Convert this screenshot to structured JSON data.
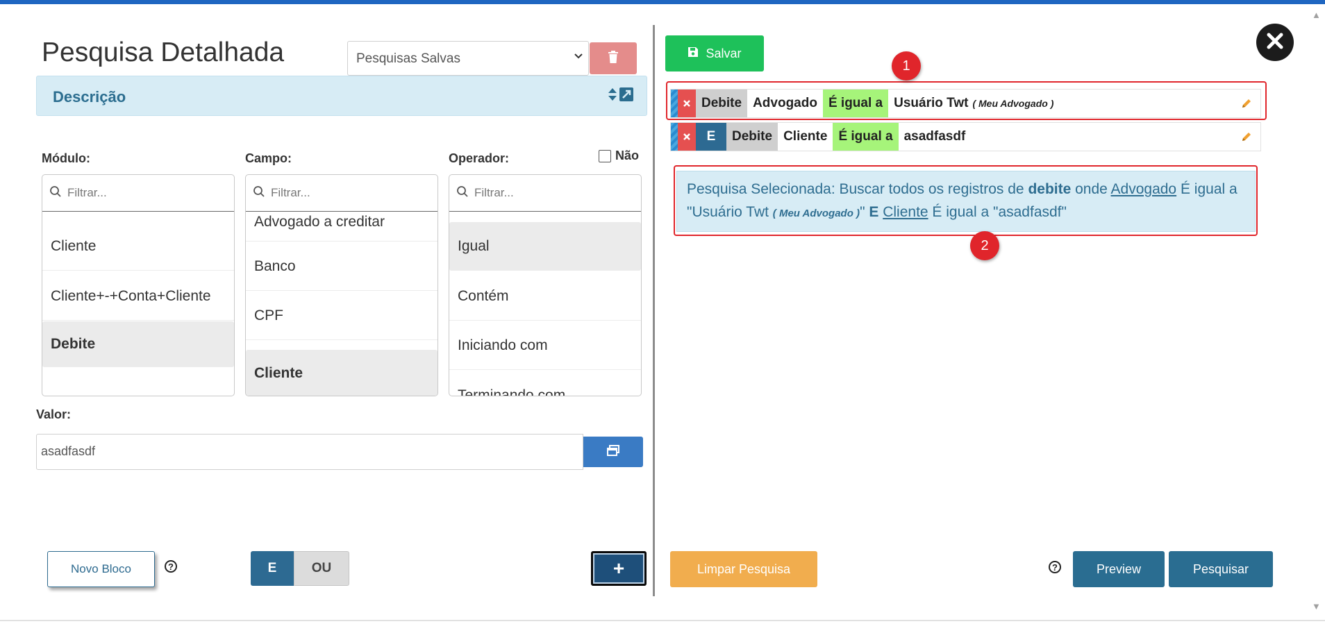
{
  "header": {
    "title": "Pesquisa Detalhada",
    "saved_searches_placeholder": "Pesquisas Salvas",
    "description_label": "Descrição"
  },
  "columns": {
    "modulo": {
      "label": "Módulo:",
      "filter_placeholder": "Filtrar...",
      "items": [
        "Cliente",
        "Cliente+-+Conta+Cliente",
        "Debite"
      ],
      "selected": "Debite"
    },
    "campo": {
      "label": "Campo:",
      "filter_placeholder": "Filtrar...",
      "items": [
        "Advogado a creditar",
        "Banco",
        "CPF",
        "Cliente"
      ],
      "selected": "Cliente"
    },
    "operador": {
      "label": "Operador:",
      "filter_placeholder": "Filtrar...",
      "items": [
        "Igual",
        "Contém",
        "Iniciando com",
        "Terminando com"
      ],
      "selected": "Igual",
      "nao_label": "Não"
    }
  },
  "valor": {
    "label": "Valor:",
    "value": "asadfasdf"
  },
  "bottom_left": {
    "novo_bloco": "Novo Bloco",
    "help": "?",
    "e": "E",
    "ou": "OU",
    "plus": "+"
  },
  "right": {
    "salvar": "Salvar",
    "rows": [
      {
        "connector": "",
        "module": "Debite",
        "field": "Advogado",
        "operator": "É igual a",
        "value": "Usuário Twt",
        "value_sub": "( Meu Advogado )"
      },
      {
        "connector": "E",
        "module": "Debite",
        "field": "Cliente",
        "operator": "É igual a",
        "value": "asadfasdf",
        "value_sub": ""
      }
    ],
    "summary": {
      "prefix": "Pesquisa Selecionada: Buscar todos os registros de ",
      "module": "debite",
      "onde": " onde ",
      "field1": "Advogado",
      "op1": " É igual a \"Usuário Twt ",
      "sub1": "( Meu Advogado )",
      "close1": "\" ",
      "conn": "E",
      "field2": "Cliente",
      "op2": " É igual a \"asadfasdf\""
    },
    "annotations": [
      "1",
      "2"
    ],
    "limpar": "Limpar Pesquisa",
    "help": "?",
    "preview": "Preview",
    "pesquisar": "Pesquisar"
  },
  "scroll": {
    "up": "▲",
    "down": "▼"
  },
  "colors": {
    "accent_blue": "#2a6d91",
    "green": "#1ec15a",
    "orange": "#f1ad4e",
    "red": "#e0252b",
    "operator_green": "#a6f47a"
  },
  "icons": {
    "trash": "trash-icon",
    "expand": "expand-icon",
    "search": "search-icon",
    "copy": "window-restore-icon",
    "save": "floppy-disk-icon",
    "close": "close-icon",
    "pencil": "pencil-icon"
  }
}
